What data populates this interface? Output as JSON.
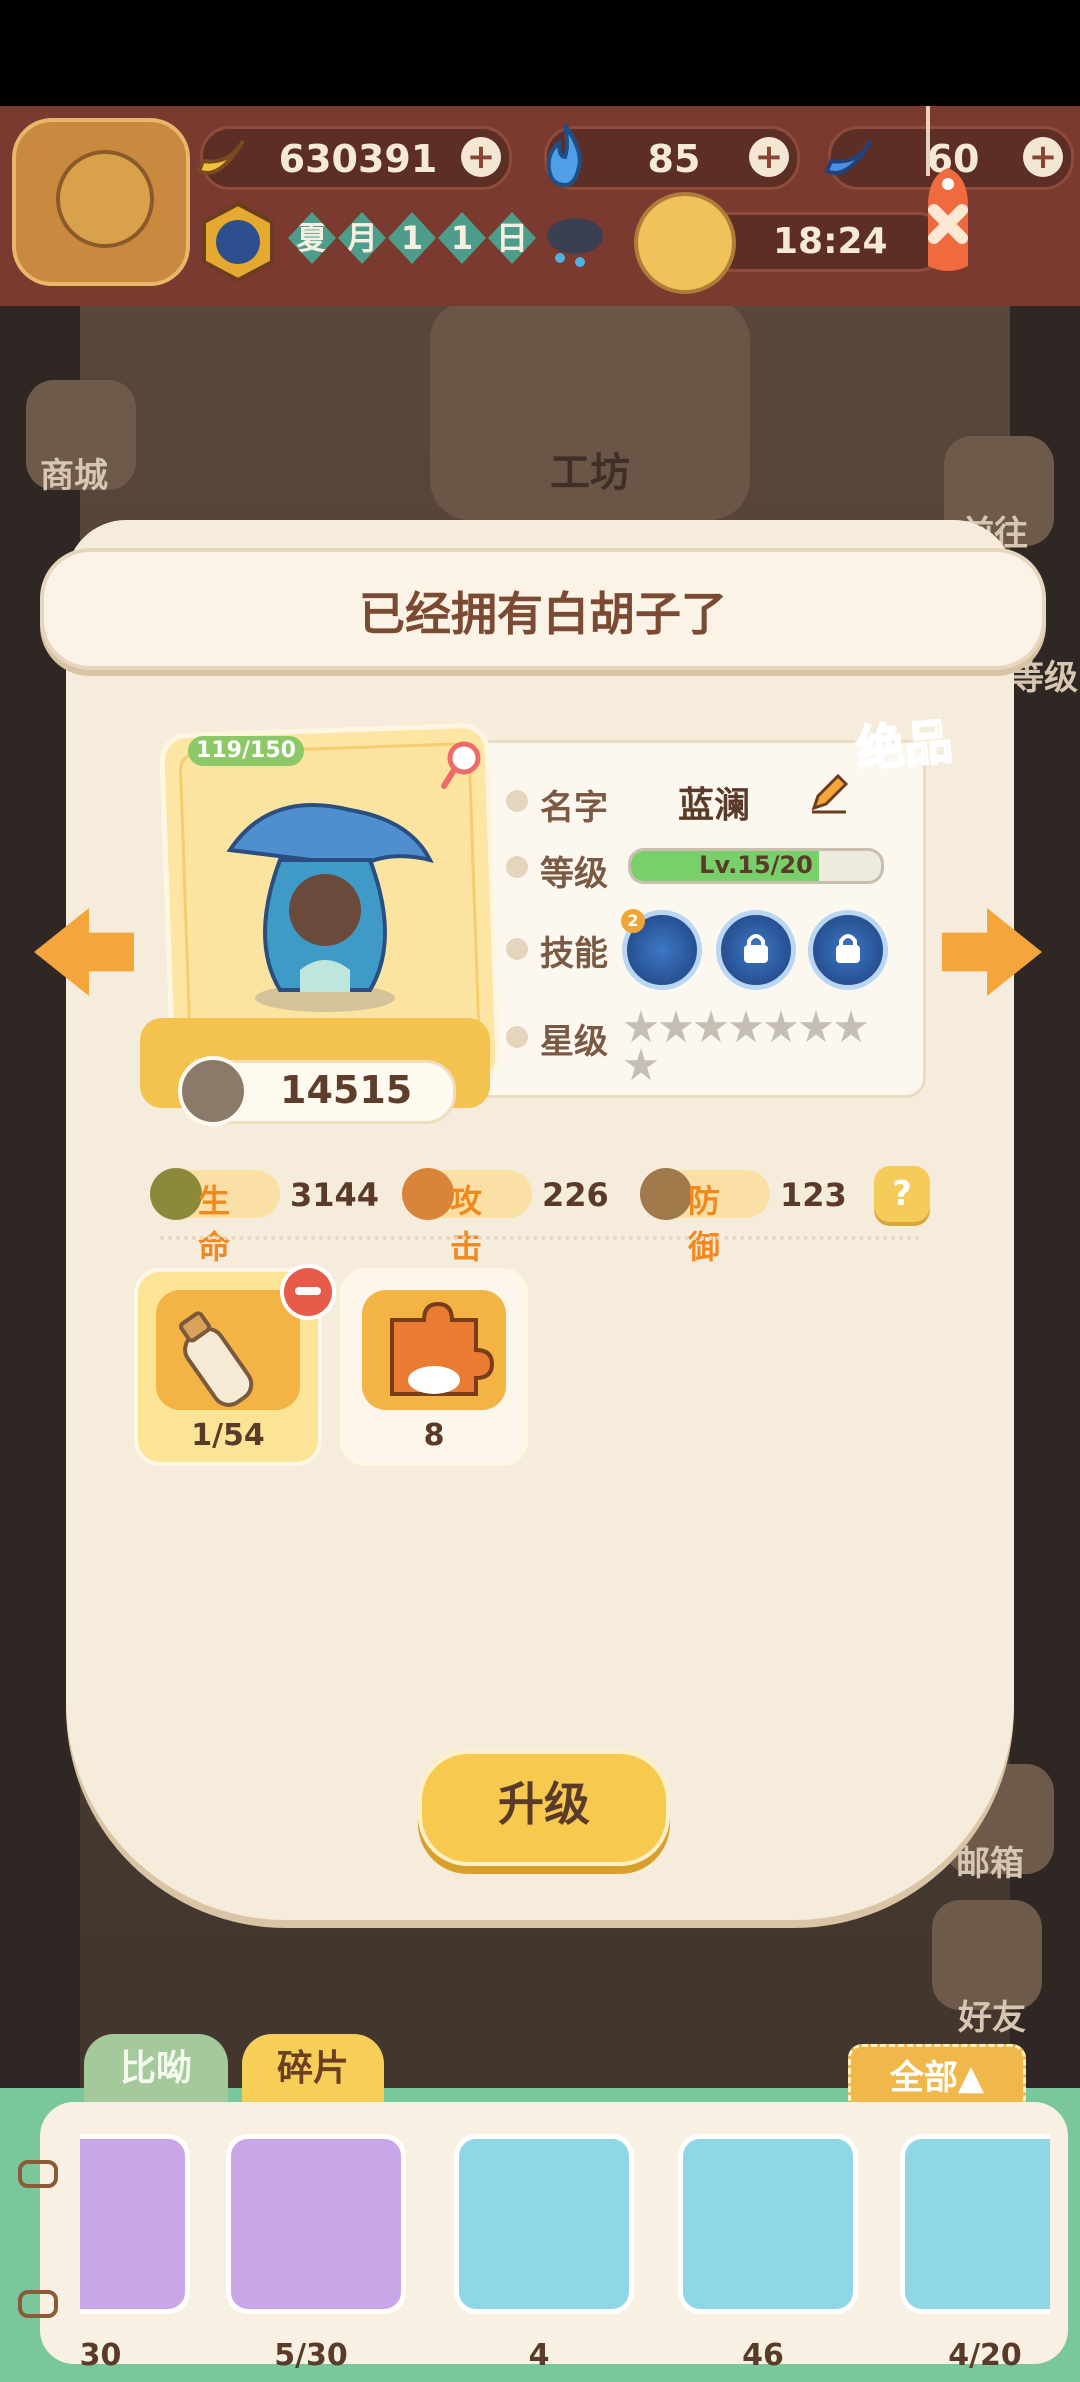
{
  "hud": {
    "banana": "630391",
    "flame": "85",
    "blue_banana": "60",
    "calendar": [
      "夏",
      "月",
      "1",
      "1",
      "日"
    ],
    "time": "18:24"
  },
  "background": {
    "shop_label": "商城",
    "workshop_label": "工坊",
    "goto_label": "前往",
    "level_label": "等级",
    "mail_label": "邮箱",
    "friends_label": "好友"
  },
  "modal": {
    "title": "已经拥有白胡子了",
    "rarity": "绝品",
    "hp_tag": "119/150",
    "power": "14515",
    "name_label": "名字",
    "name_value": "蓝澜",
    "level_label": "等级",
    "level_text": "Lv.15/20",
    "level_progress": 0.75,
    "skill_label": "技能",
    "skill_level": "2",
    "star_label": "星级",
    "stars_total": 8,
    "stars_filled": 0,
    "stats": [
      {
        "name": "生命",
        "value": "3144"
      },
      {
        "name": "攻击",
        "value": "226"
      },
      {
        "name": "防御",
        "value": "123"
      }
    ],
    "help": "?",
    "items": [
      {
        "count": "1/54"
      },
      {
        "count": "8"
      }
    ],
    "upgrade": "升级"
  },
  "tray": {
    "tab_biyou": "比呦",
    "tab_fragments": "碎片",
    "filter": "全部▲",
    "fragments": [
      {
        "count": "/30",
        "color": "#c9a6e8"
      },
      {
        "count": "5/30",
        "color": "#c9a6e8"
      },
      {
        "count": "4",
        "color": "#8fd6e6"
      },
      {
        "count": "46",
        "color": "#8fd6e6"
      },
      {
        "count": "4/20",
        "color": "#8fd6e6"
      }
    ]
  },
  "colors": {
    "accent": "#f4a53b",
    "panel": "#f6ecdc",
    "tray": "#79c79a"
  }
}
